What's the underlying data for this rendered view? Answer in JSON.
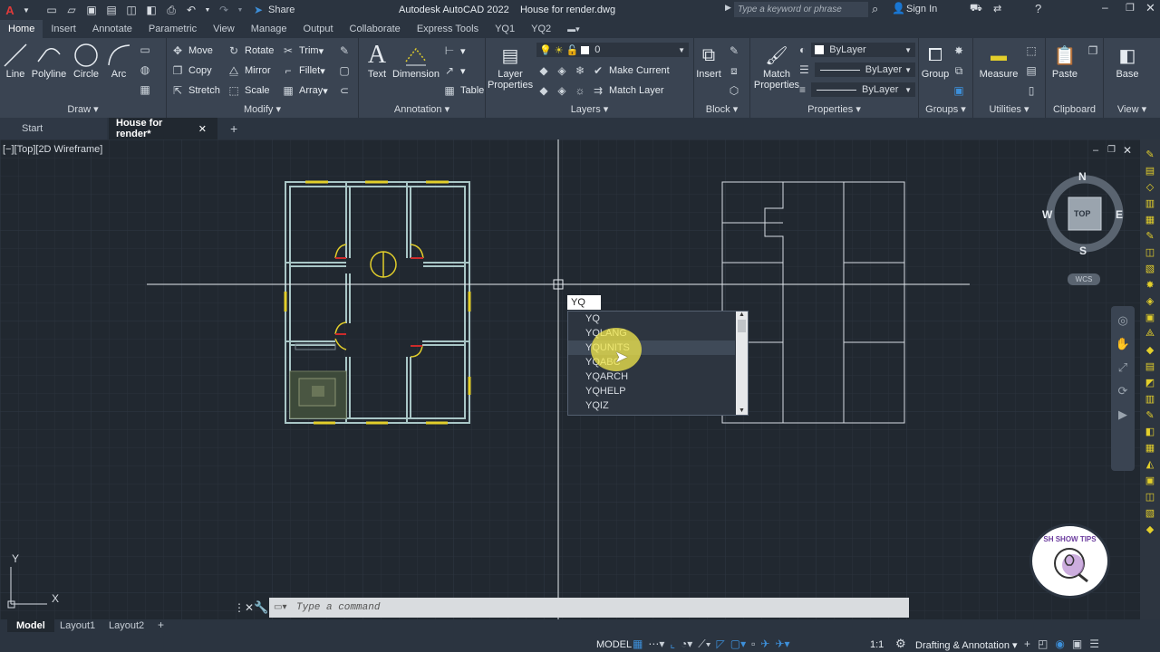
{
  "app": {
    "title": "Autodesk AutoCAD 2022",
    "document": "House for render.dwg",
    "share_label": "Share",
    "search_placeholder": "Type a keyword or phrase",
    "signin_label": "Sign In"
  },
  "ribbon_tabs": [
    "Home",
    "Insert",
    "Annotate",
    "Parametric",
    "View",
    "Manage",
    "Output",
    "Collaborate",
    "Express Tools",
    "YQ1",
    "YQ2"
  ],
  "panels": {
    "draw": {
      "title": "Draw",
      "line": "Line",
      "polyline": "Polyline",
      "circle": "Circle",
      "arc": "Arc"
    },
    "modify": {
      "title": "Modify",
      "move": "Move",
      "rotate": "Rotate",
      "trim": "Trim",
      "copy": "Copy",
      "mirror": "Mirror",
      "fillet": "Fillet",
      "stretch": "Stretch",
      "scale": "Scale",
      "array": "Array"
    },
    "annotation": {
      "title": "Annotation",
      "text": "Text",
      "dimension": "Dimension",
      "table": "Table"
    },
    "layers": {
      "title": "Layers",
      "layer_properties_1": "Layer",
      "layer_properties_2": "Properties",
      "layer_value": "0",
      "make_current": "Make Current",
      "match_layer": "Match Layer"
    },
    "block": {
      "title": "Block",
      "insert": "Insert"
    },
    "properties": {
      "title": "Properties",
      "match_1": "Match",
      "match_2": "Properties",
      "bylayer1": "ByLayer",
      "bylayer2": "ByLayer",
      "bylayer3": "ByLayer"
    },
    "groups": {
      "title": "Groups",
      "group": "Group"
    },
    "utilities": {
      "title": "Utilities",
      "measure": "Measure"
    },
    "clipboard": {
      "title": "Clipboard",
      "paste": "Paste"
    },
    "view": {
      "title": "View",
      "base": "Base"
    }
  },
  "doc_tabs": {
    "start": "Start",
    "current": "House for render*"
  },
  "viewport_label": "[−][Top][2D Wireframe]",
  "viewcube": {
    "top": "TOP",
    "n": "N",
    "s": "S",
    "e": "E",
    "w": "W",
    "wcs": "WCS"
  },
  "ucs": {
    "x": "X",
    "y": "Y"
  },
  "autocomplete": {
    "input": "YQ",
    "items": [
      "YQ",
      "YQLANG",
      "YQUNITS",
      "YQABC",
      "YQARCH",
      "YQHELP",
      "YQIZ"
    ],
    "highlighted_index": 2
  },
  "command": {
    "placeholder": "Type a command"
  },
  "layout_tabs": [
    "Model",
    "Layout1",
    "Layout2"
  ],
  "status": {
    "model": "MODEL",
    "scale": "1:1",
    "workspace": "Drafting & Annotation"
  },
  "watermark": "SH SHOW TIPS",
  "colors": {
    "accent": "#3d8fd9",
    "wall": "#a9c6c6",
    "door": "#e3cf2b",
    "highlight": "#f4e94c"
  }
}
